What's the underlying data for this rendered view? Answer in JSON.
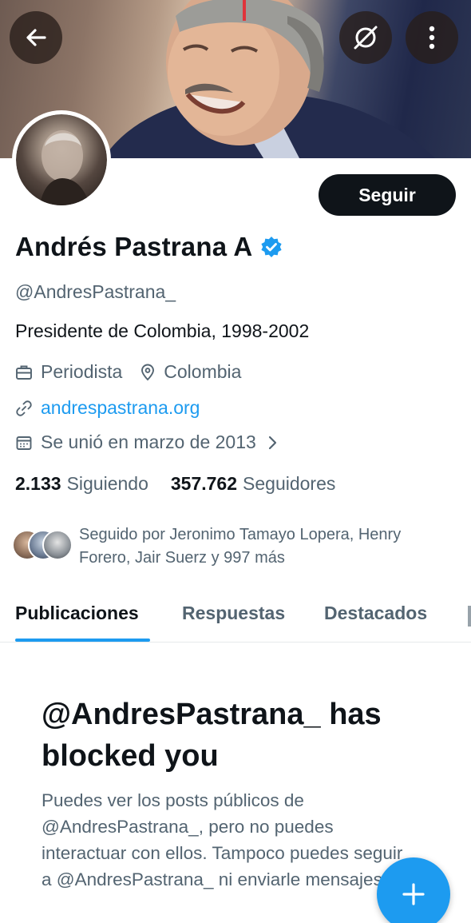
{
  "header": {
    "back_icon": "arrow-left-icon",
    "nosync_icon": "no-sync-icon",
    "more_icon": "more-vertical-icon"
  },
  "profile": {
    "follow_label": "Seguir",
    "name": "Andrés Pastrana A",
    "verified_icon": "verified-badge-icon",
    "handle": "@AndresPastrana_",
    "bio": "Presidente de Colombia, 1998-2002",
    "profession": "Periodista",
    "location": "Colombia",
    "website": "andrespastrana.org",
    "joined": "Se unió en marzo de 2013",
    "following_count": "2.133",
    "following_label": "Siguiendo",
    "followers_count": "357.762",
    "followers_label": "Seguidores",
    "followed_by": "Seguido por Jeronimo Tamayo Lopera, Henry Forero, Jair Suerz y 997 más"
  },
  "tabs": [
    {
      "label": "Publicaciones",
      "active": true
    },
    {
      "label": "Respuestas",
      "active": false
    },
    {
      "label": "Destacados",
      "active": false
    }
  ],
  "blocked": {
    "title": "@AndresPastrana_ has blocked you",
    "description": "Puedes ver los posts públicos de @AndresPastrana_, pero no puedes interactuar con ellos. Tampoco puedes seguir a @AndresPastrana_ ni enviarle mensajes."
  },
  "fab": {
    "icon": "plus-icon"
  },
  "colors": {
    "accent": "#1d9bf0",
    "text_primary": "#0f1419",
    "text_secondary": "#536471",
    "button_dark": "#0f1419"
  }
}
